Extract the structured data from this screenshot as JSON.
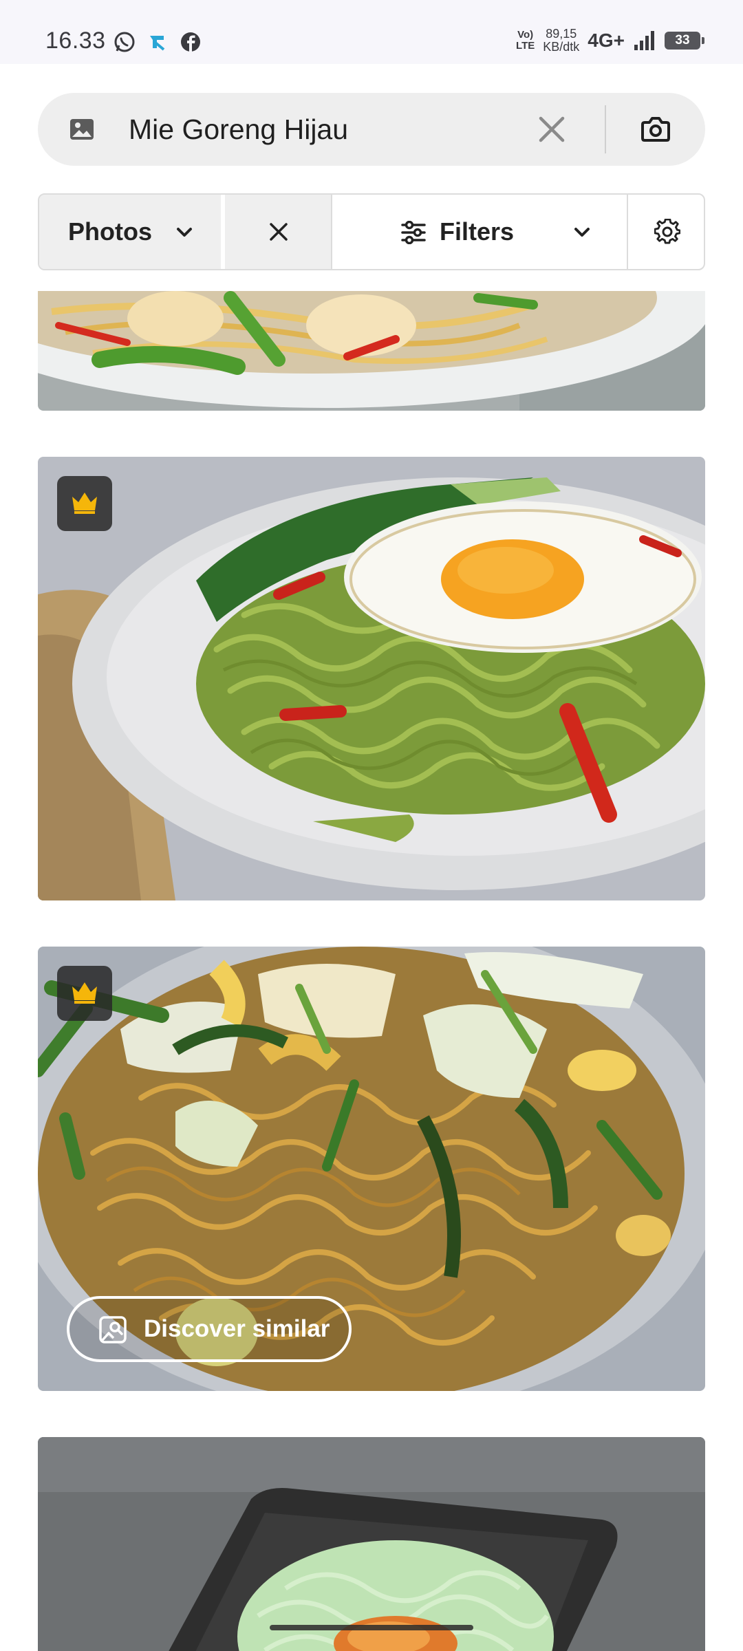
{
  "status_bar": {
    "time": "16.33",
    "volte": "Vo)\nLTE",
    "speed_value": "89,15",
    "speed_unit": "KB/dtk",
    "network": "4G+",
    "battery": "33",
    "notification_icons": [
      "whatsapp-icon",
      "app-icon",
      "facebook-icon"
    ]
  },
  "search": {
    "query": "Mie Goreng Hijau",
    "leading_icon": "image-search-icon",
    "clear_icon": "close-icon",
    "camera_icon": "camera-icon"
  },
  "filters": {
    "type_label": "Photos",
    "filters_label": "Filters",
    "settings_icon": "gear-icon"
  },
  "results": [
    {
      "description": "fried noodles with green beans and chili on white plate",
      "premium": false
    },
    {
      "description": "green noodles with fried egg on white plate",
      "premium": true
    },
    {
      "description": "fried instant noodles with vegetables",
      "premium": true,
      "action": "Discover similar"
    },
    {
      "description": "green noodles on dark square plate",
      "premium": false
    }
  ],
  "discover_label": "Discover similar",
  "colors": {
    "premium_crown": "#f5b60a",
    "search_bg": "#eeeeee",
    "status_bg": "#f7f6fb"
  }
}
